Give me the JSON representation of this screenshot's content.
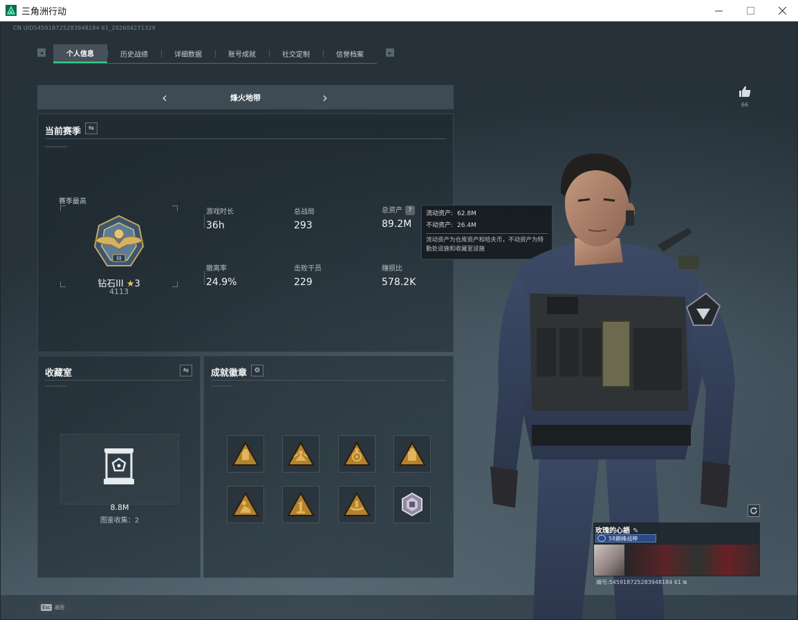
{
  "window": {
    "title": "三角洲行动",
    "minimize_icon": "minimize-icon",
    "maximize_icon": "maximize-icon",
    "close_icon": "close-icon"
  },
  "header": {
    "uid_text": "CN UID545918725283948184 61_202604271329"
  },
  "tabs": [
    {
      "label": "个人信息",
      "active": true
    },
    {
      "label": "历史战绩",
      "active": false
    },
    {
      "label": "详细数据",
      "active": false
    },
    {
      "label": "账号成就",
      "active": false
    },
    {
      "label": "社交定制",
      "active": false
    },
    {
      "label": "信誉档案",
      "active": false
    }
  ],
  "mode_selector": {
    "label": "烽火地带"
  },
  "season": {
    "title": "当前赛季",
    "rank_caption": "赛季最高",
    "rank_name": "钻石III",
    "rank_stars": "3",
    "rank_score": "4113",
    "stats": [
      {
        "label": "游戏时长",
        "value": "36h"
      },
      {
        "label": "总战局",
        "value": "293"
      },
      {
        "label": "总资产",
        "value": "89.2M",
        "has_help": true
      },
      {
        "label": "撤离率",
        "value": "24.9%"
      },
      {
        "label": "击败干员",
        "value": "229"
      },
      {
        "label": "赚损比",
        "value": "578.2K"
      }
    ],
    "tooltip": {
      "liquid_label": "流动资产:",
      "liquid_value": "62.8M",
      "fixed_label": "不动资产:",
      "fixed_value": "26.4M",
      "description": "流动资产为仓库资产和哈夫币，不动资产为特勤处设施和收藏室设施"
    }
  },
  "collection": {
    "title": "收藏室",
    "value": "8.8M",
    "count_text": "图鉴收集：2"
  },
  "achievements": {
    "title": "成就徽章",
    "medal_count": 8
  },
  "profile": {
    "like_count": "66",
    "card_name": "玫瑰的心語",
    "card_badge": "58巅峰战神",
    "card_uid": "编号:545918725283948184 61"
  },
  "footer": {
    "esc_key": "Esc",
    "esc_label": "返回"
  },
  "colors": {
    "accent": "#2fd08b",
    "gold": "#c99a3c",
    "panel_bg": "#1c262d"
  }
}
